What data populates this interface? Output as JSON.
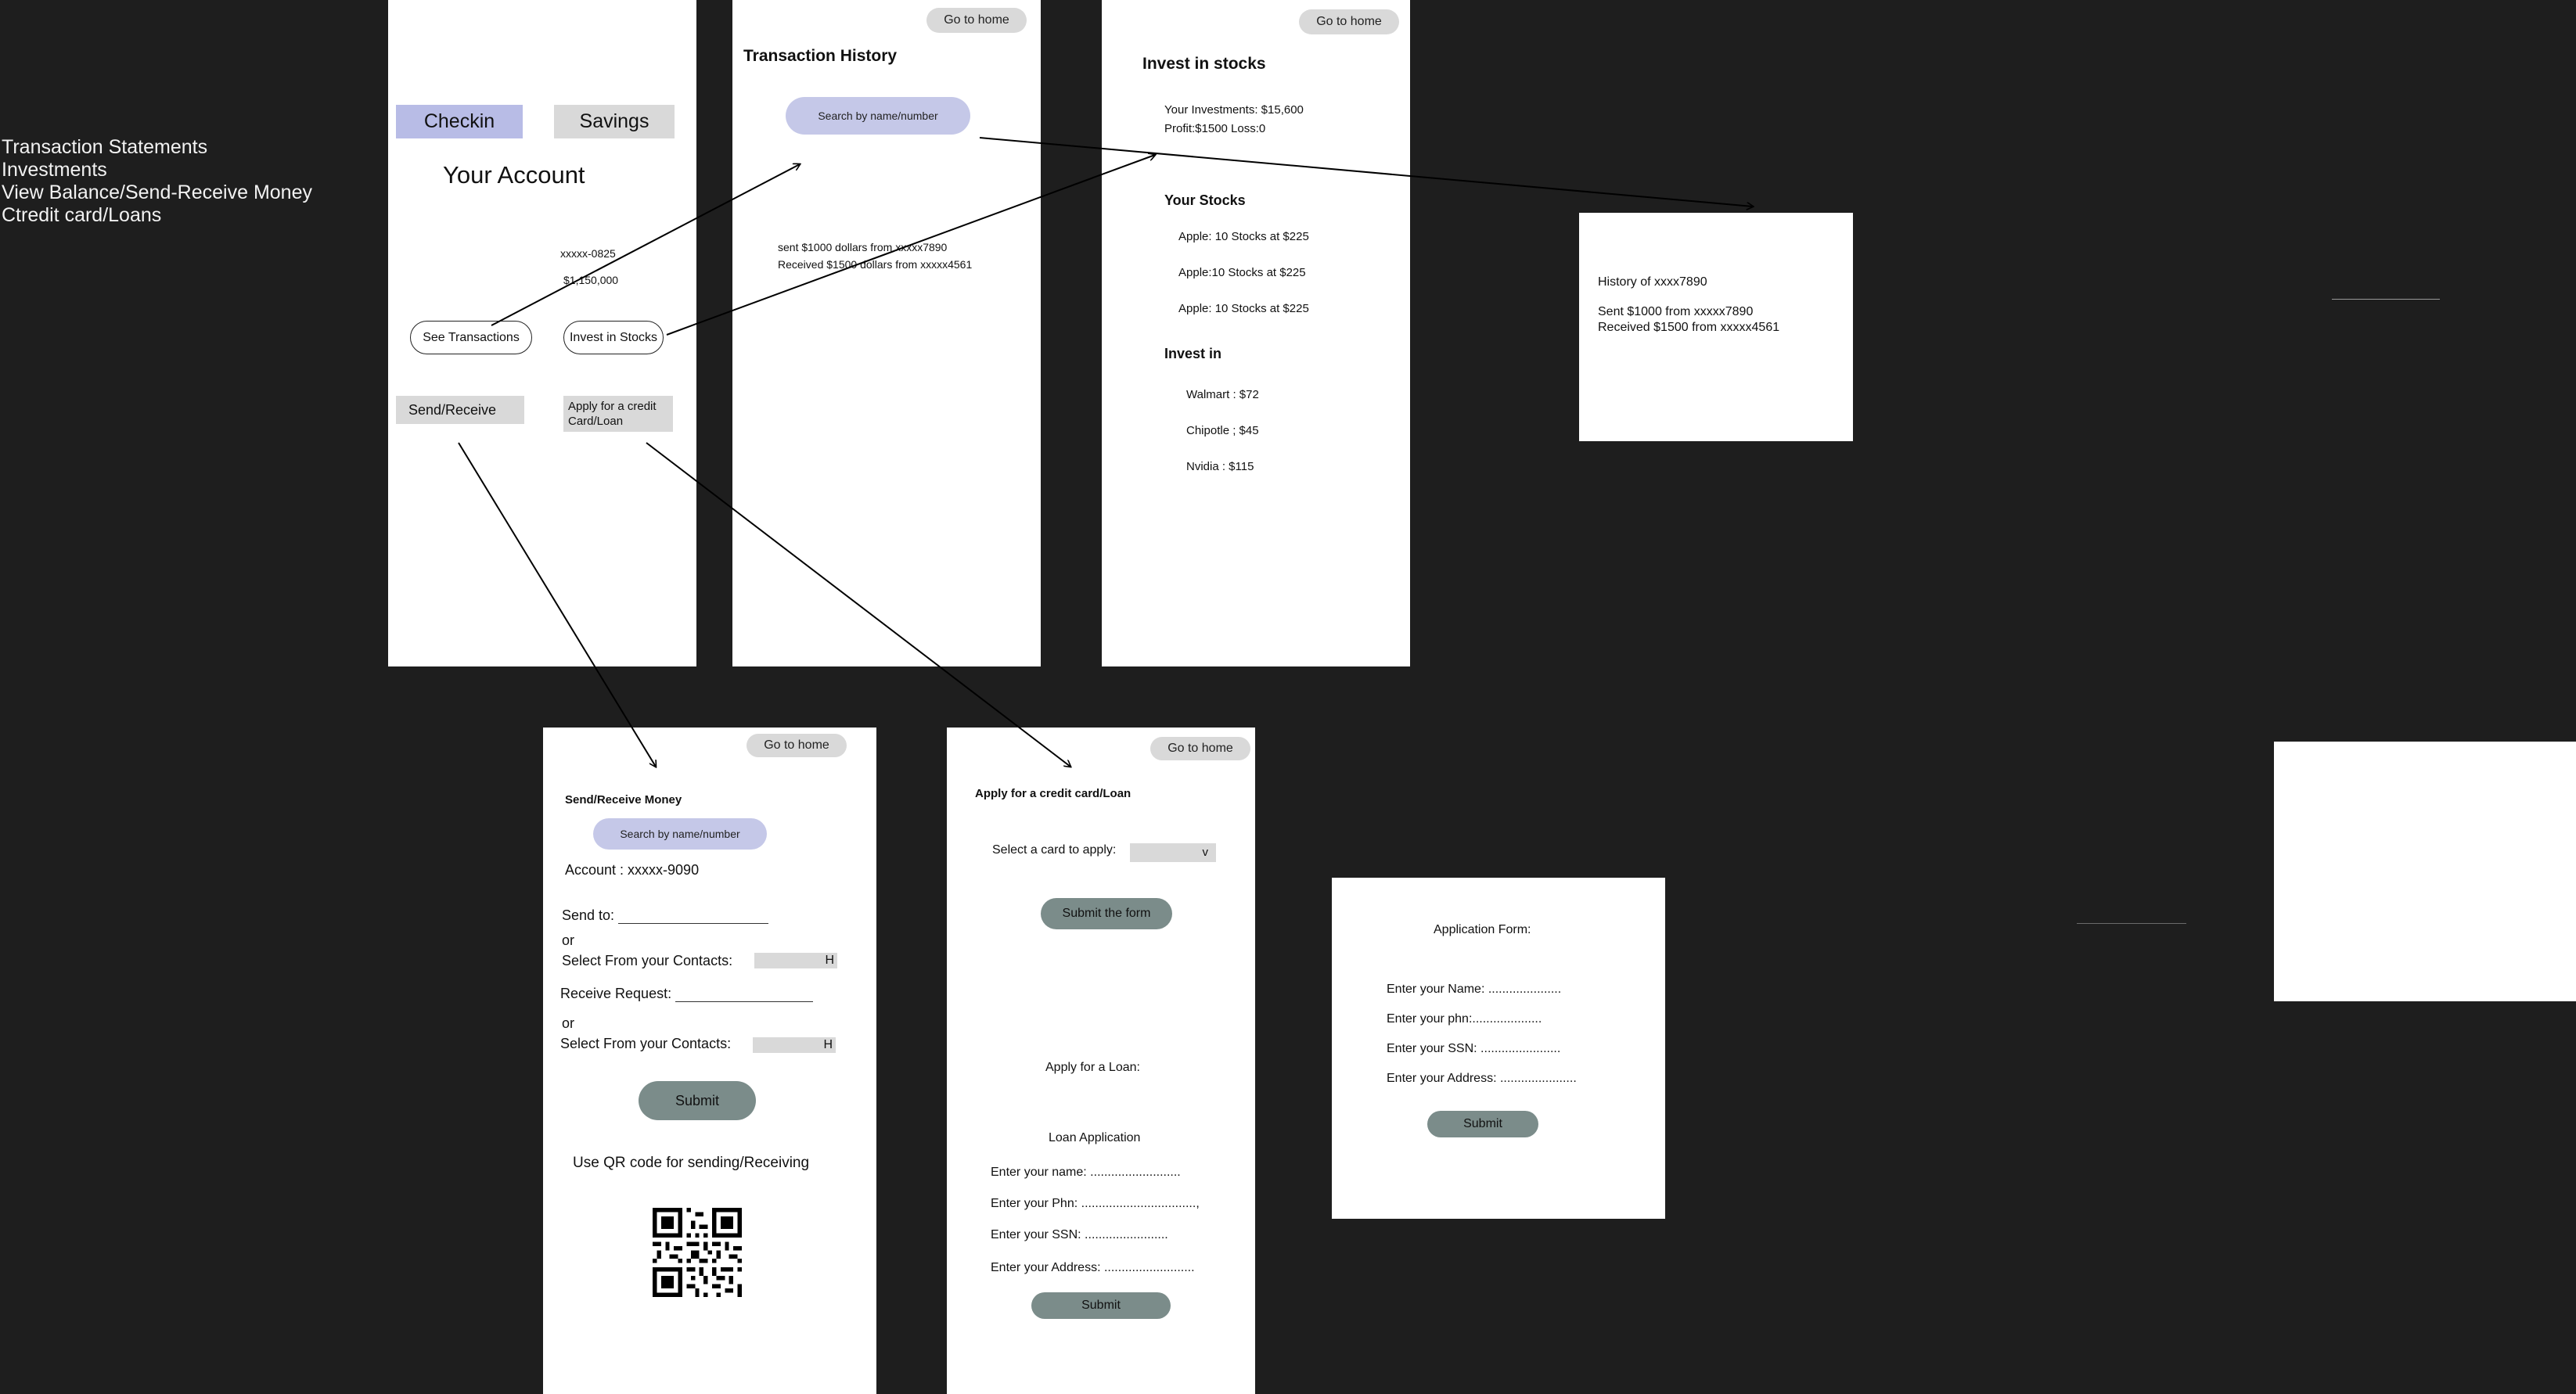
{
  "notes": {
    "items": [
      "Transaction Statements",
      "Investments",
      "View Balance/Send-Receive Money",
      "Ctredit card/Loans"
    ]
  },
  "account": {
    "tab_checkin": "Checkin",
    "tab_savings": "Savings",
    "title": "Your Account",
    "account_number": "xxxxx-0825",
    "balance": "$1,150,000",
    "see_transactions": "See Transactions",
    "invest_in_stocks": "Invest in Stocks",
    "send_receive": "Send/Receive",
    "apply_credit": "Apply for a credit Card/Loan",
    "colors": {
      "checkin_bg": "#b8bce6",
      "gray_bg": "#d9d9d9"
    }
  },
  "history": {
    "go_home": "Go to home",
    "title": "Transaction History",
    "search_placeholder": "Search by name/number",
    "line1": "sent $1000 dollars from xxxxx7890",
    "line2": "Received $1500 dollars from xxxxx4561"
  },
  "stocks": {
    "go_home": "Go to home",
    "title": "Invest in stocks",
    "investments": "Your Investments: $15,600",
    "profit_loss": "Profit:$1500 Loss:0",
    "your_stocks_title": "Your Stocks",
    "your_stocks": [
      "Apple: 10 Stocks at $225",
      "Apple:10 Stocks at $225",
      "Apple: 10 Stocks at $225"
    ],
    "invest_in_title": "Invest in",
    "invest_in": [
      "Walmart : $72",
      "Chipotle ; $45",
      "Nvidia : $115"
    ]
  },
  "detail": {
    "title": "History of xxxx7890",
    "line1": "Sent $1000 from xxxxx7890",
    "line2": "Received $1500 from xxxxx4561"
  },
  "send": {
    "go_home": "Go to home",
    "title": "Send/Receive Money",
    "search_placeholder": "Search by name/number",
    "account": "Account : xxxxx-9090",
    "send_to": "Send to:",
    "or1": "or",
    "select_contacts1": "Select From your Contacts:",
    "dropdown_glyph": "H",
    "receive_request": "Receive Request:",
    "or2": "or",
    "select_contacts2": "Select From your Contacts:",
    "submit": "Submit",
    "qr_label": "Use QR code for sending/Receiving"
  },
  "apply": {
    "go_home": "Go to home",
    "title": "Apply for a credit card/Loan",
    "select_card": "Select a card to apply:",
    "select_value": "v",
    "submit_form": "Submit the form",
    "apply_loan": "Apply for a Loan:",
    "loan_app": "Loan  Application",
    "name": "Enter your name: ..........................",
    "phone": "Enter your Phn:  .................................,",
    "ssn": "Enter your SSN: ........................",
    "address": "Enter your Address: ..........................",
    "submit": "Submit"
  },
  "form": {
    "title": "Application Form:",
    "name": "Enter your Name: .....................",
    "phone": "Enter your phn:....................",
    "ssn": "Enter your SSN: .......................",
    "address": "Enter your Address: ......................",
    "submit": "Submit"
  },
  "colors": {
    "canvas": "#1e1e1e",
    "frame": "#ffffff",
    "search_pill": "#c5c8e8",
    "dark_pill": "#7b8c8a"
  }
}
